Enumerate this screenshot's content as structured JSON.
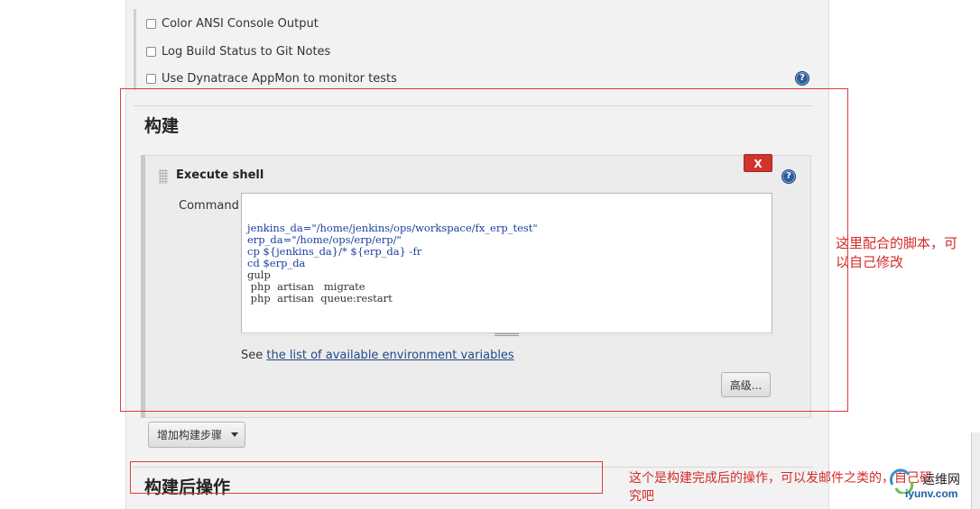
{
  "options": {
    "color_ansi": "Color ANSI Console Output",
    "git_notes": "Log Build Status to Git Notes",
    "dynatrace": "Use Dynatrace AppMon to monitor tests"
  },
  "build_section": {
    "title": "构建",
    "step": {
      "title": "Execute shell",
      "delete_label": "X",
      "command_label": "Command",
      "command_lines": [
        "jenkins_da=\"/home/jenkins/ops/workspace/fx_erp_test\"",
        "erp_da=\"/home/ops/erp/erp/\"",
        "cp ${jenkins_da}/* ${erp_da} -fr",
        "cd $erp_da",
        "gulp",
        " php  artisan   migrate",
        " php  artisan  queue:restart"
      ],
      "see_prefix": "See ",
      "see_link": "the list of available environment variables",
      "advanced_label": "高级..."
    },
    "add_step_label": "增加构建步骤"
  },
  "post_build_section": {
    "title": "构建后操作"
  },
  "annotations": {
    "script_note_line1": "这里配合的脚本，可",
    "script_note_line2": "以自己修改",
    "post_note_line1": "这个是构建完成后的操作，可以发邮件之类的，自己研",
    "post_note_line2": "究吧"
  },
  "watermark": {
    "line1": "运维网",
    "line2": "iyunv.com"
  },
  "help_icon": "?",
  "colors": {
    "annotation_red": "#e23b3b",
    "delete_red": "#d0342c",
    "link_blue": "#204a87"
  }
}
